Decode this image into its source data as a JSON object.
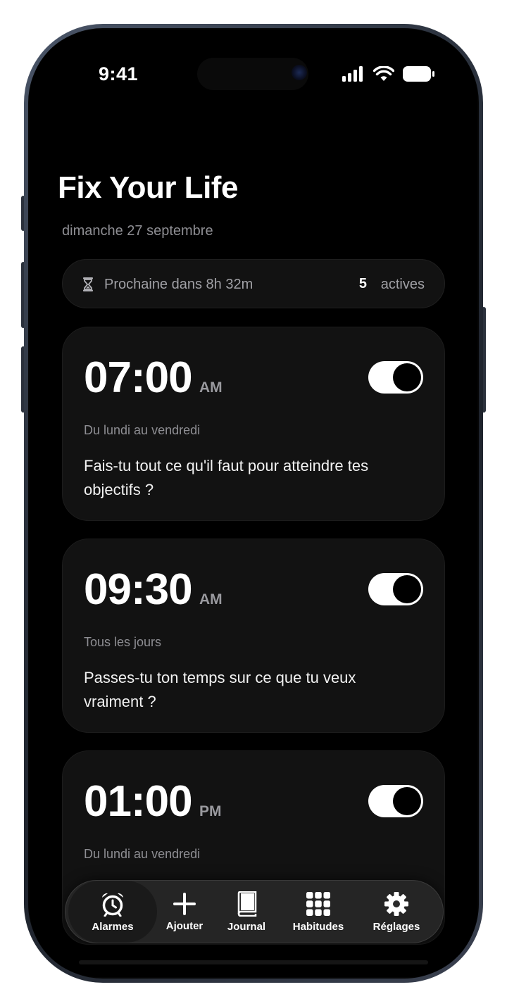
{
  "status": {
    "time": "9:41"
  },
  "header": {
    "title": "Fix Your Life",
    "date": "dimanche 27 septembre"
  },
  "summary": {
    "next_label": "Prochaine dans 8h 32m",
    "active_count": "5",
    "active_label": "actives"
  },
  "alarms": [
    {
      "time": "07:00",
      "period": "AM",
      "schedule": "Du lundi au vendredi",
      "question": "Fais-tu tout ce qu'il faut pour atteindre tes objectifs ?",
      "enabled": true
    },
    {
      "time": "09:30",
      "period": "AM",
      "schedule": "Tous les jours",
      "question": "Passes-tu ton temps sur ce que tu veux vraiment ?",
      "enabled": true
    },
    {
      "time": "01:00",
      "period": "PM",
      "schedule": "Du lundi au vendredi",
      "question": "",
      "enabled": true
    }
  ],
  "tabs": [
    {
      "label": "Alarmes",
      "icon": "alarm-clock-icon",
      "active": true
    },
    {
      "label": "Ajouter",
      "icon": "plus-icon",
      "active": false
    },
    {
      "label": "Journal",
      "icon": "book-icon",
      "active": false
    },
    {
      "label": "Habitudes",
      "icon": "grid-icon",
      "active": false
    },
    {
      "label": "Réglages",
      "icon": "gear-icon",
      "active": false
    }
  ]
}
